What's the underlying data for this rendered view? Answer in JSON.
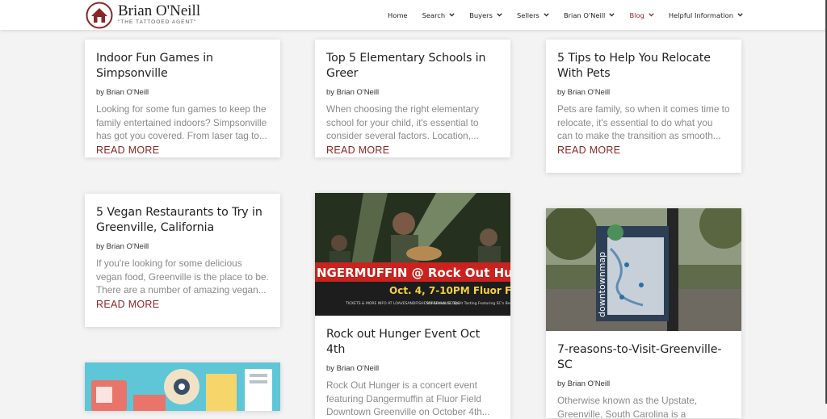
{
  "brand": {
    "name": "Brian O'Neill",
    "tagline": "\"THE TATTOOED AGENT\""
  },
  "nav": [
    {
      "label": "Home",
      "dropdown": false,
      "active": false
    },
    {
      "label": "Search",
      "dropdown": true,
      "active": false
    },
    {
      "label": "Buyers",
      "dropdown": true,
      "active": false
    },
    {
      "label": "Sellers",
      "dropdown": true,
      "active": false
    },
    {
      "label": "Brian O'Neill",
      "dropdown": true,
      "active": false
    },
    {
      "label": "Blog",
      "dropdown": true,
      "active": true
    },
    {
      "label": "Helpful Information",
      "dropdown": true,
      "active": false
    }
  ],
  "posts": [
    {
      "title": "Indoor Fun Games in Simpsonville",
      "byline": "by Brian O'Neill",
      "excerpt": "Looking for some fun games to keep the family entertained indoors? Simpsonville has got you covered. From laser tag to...",
      "more": "READ MORE"
    },
    {
      "title": "Top 5 Elementary Schools in Greer",
      "byline": "by Brian O'Neill",
      "excerpt": "When choosing the right elementary school for your child, it's essential to consider several factors. Location,...",
      "more": "READ MORE"
    },
    {
      "title": "5 Tips to Help You Relocate With Pets",
      "byline": "by Brian O'Neill",
      "excerpt": "Pets are family, so when it comes time to relocate, it's essential to do what you can to make the transition as smooth...",
      "more": "READ MORE"
    },
    {
      "title": "5 Vegan Restaurants to Try in Greenville, California",
      "byline": "by Brian O'Neill",
      "excerpt": "If you're looking for some delicious vegan food, Greenville is the place to be. There are a number of amazing vegan...",
      "more": "READ MORE"
    },
    {
      "title": "Rock out Hunger Event Oct 4th",
      "byline": "by Brian O'Neill",
      "excerpt": "Rock Out Hunger is a concert event featuring Dangermuffin at Fluor Field Downtown Greenville on October 4th...",
      "image": {
        "banner": "NGERMUFFIN @ Rock Out Hung",
        "date": "Oct. 4, 7-10PM Fluor Fi",
        "tickets": "TICKETS & MORE INFO AT LOAVESANDFISHESGREENVILLE.ORG",
        "tasting": "5th Annual SC Spirit Tasting Featuring SC's Best Distilleries"
      }
    },
    {
      "title": "7-reasons-to-Visit-Greenville-SC",
      "byline": "by Brian O'Neill",
      "excerpt": "Otherwise known as the Upstate, Greenville, South Carolina is a wonderful...",
      "image": {
        "map_label": "downtownmap"
      }
    },
    {
      "image": {
        "kind": "illustration"
      }
    }
  ]
}
